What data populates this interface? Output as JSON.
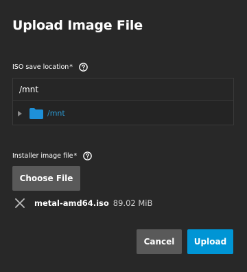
{
  "dialog": {
    "title": "Upload Image File"
  },
  "iso_location": {
    "label": "ISO save location",
    "required_marker": "*",
    "path_value": "/mnt",
    "tree": {
      "items": [
        {
          "label": "/mnt",
          "icon": "folder-icon",
          "expanded": false
        }
      ]
    }
  },
  "installer": {
    "label": "Installer image file",
    "required_marker": "*",
    "choose_label": "Choose File",
    "file_name": "metal-amd64.iso",
    "file_size": "89.02 MiB"
  },
  "actions": {
    "cancel_label": "Cancel",
    "upload_label": "Upload"
  },
  "colors": {
    "background": "#282828",
    "accent": "#0095d5",
    "link": "#2b9bd6",
    "secondary_button": "#595959",
    "folder": "#1e90d8"
  }
}
